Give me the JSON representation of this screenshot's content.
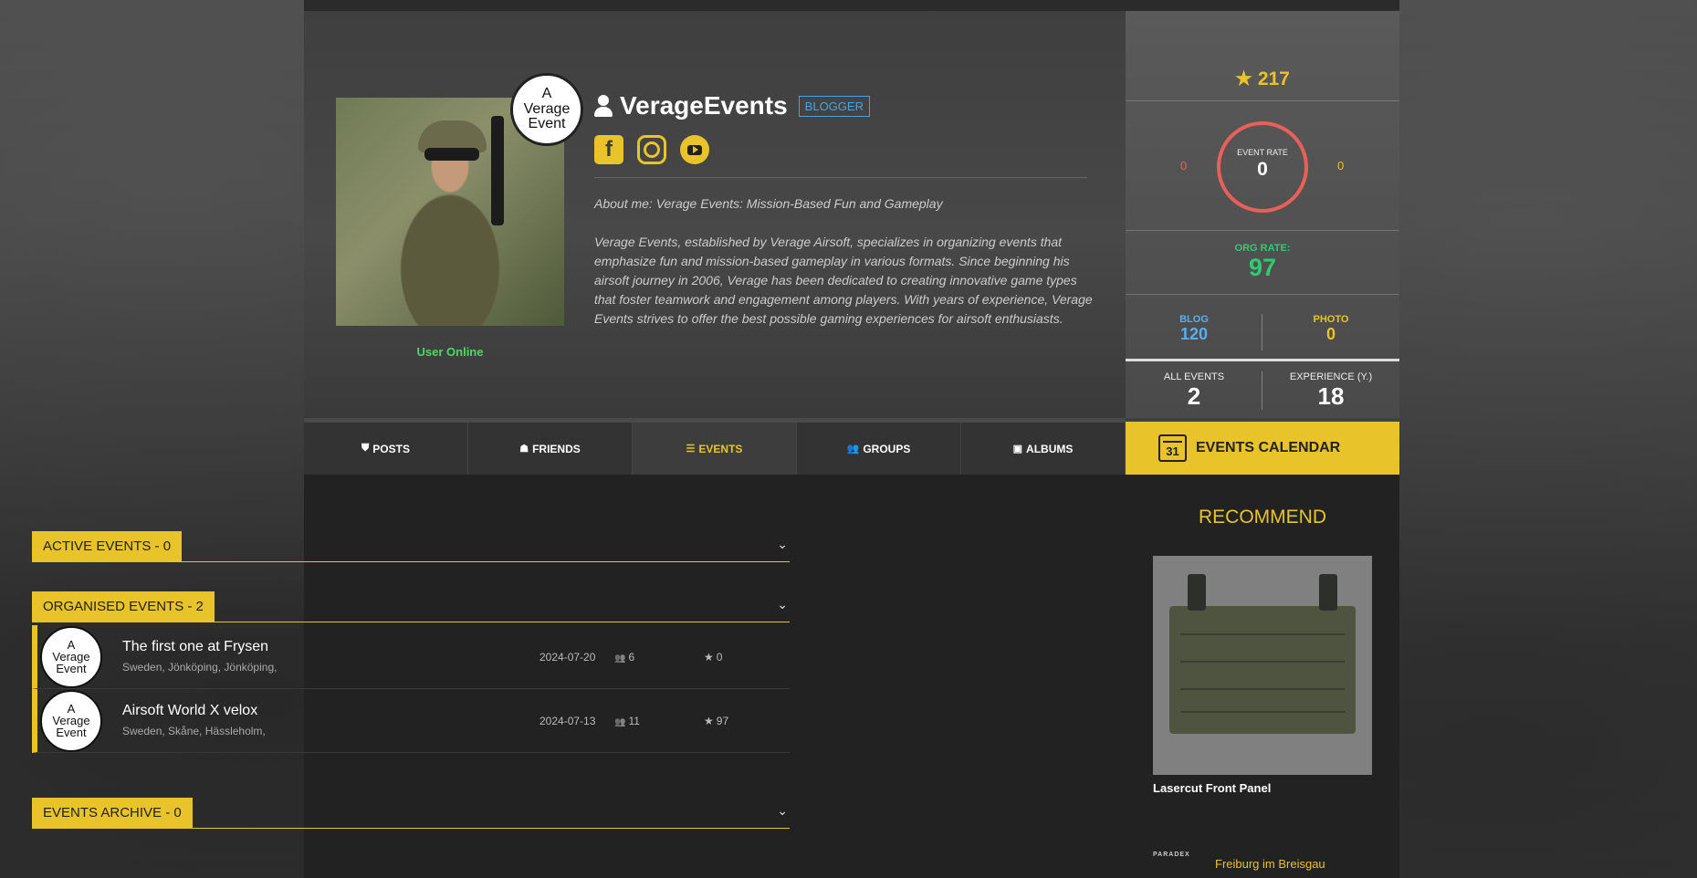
{
  "profile": {
    "username": "VerageEvents",
    "role_badge": "BLOGGER",
    "status": "User Online",
    "logo_lines": [
      "A",
      "Verage",
      "Event"
    ],
    "about_title": "About me: Verage Events: Mission-Based Fun and Gameplay",
    "about_text": "Verage Events, established by Verage Airsoft, specializes in organizing events that emphasize fun and mission-based gameplay in various formats. Since beginning his airsoft journey in 2006, Verage has been dedicated to creating innovative game types that foster teamwork and engagement among players. With years of experience, Verage Events strives to offer the best possible gaming experiences for airsoft enthusiasts.",
    "socials": [
      "facebook-icon",
      "instagram-icon",
      "youtube-icon"
    ]
  },
  "stats": {
    "rating": "217",
    "event_rate_label": "EVENT RATE",
    "event_rate_value": "0",
    "event_rate_left": "0",
    "event_rate_right": "0",
    "org_rate_label": "ORG RATE:",
    "org_rate_value": "97",
    "blog_label": "BLOG",
    "blog_value": "120",
    "photo_label": "PHOTO",
    "photo_value": "0",
    "all_events_label": "ALL EVENTS",
    "all_events_value": "2",
    "experience_label": "EXPERIENCE (Y.)",
    "experience_value": "18"
  },
  "tabs": [
    {
      "label": "POSTS",
      "icon": "shield-icon"
    },
    {
      "label": "FRIENDS",
      "icon": "person-icon"
    },
    {
      "label": "EVENTS",
      "icon": "list-icon",
      "active": true
    },
    {
      "label": "GROUPS",
      "icon": "users-icon"
    },
    {
      "label": "ALBUMS",
      "icon": "image-icon"
    }
  ],
  "calendar": {
    "label": "EVENTS CALENDAR",
    "icon_number": "31"
  },
  "sections": {
    "active": "ACTIVE EVENTS - 0",
    "organised": "ORGANISED EVENTS - 2",
    "archive": "EVENTS ARCHIVE - 0"
  },
  "events": [
    {
      "name": "The first one at Frysen",
      "location": "Sweden, Jönköping, Jönköping,",
      "date": "2024-07-20",
      "participants": "6",
      "rating": "0"
    },
    {
      "name": "Airsoft World X velox",
      "location": "Sweden, Skåne, Hässleholm,",
      "date": "2024-07-13",
      "participants": "11",
      "rating": "97"
    }
  ],
  "recommend": {
    "title": "RECOMMEND",
    "product_name": "Lasercut Front Panel",
    "brand": "PARADEX",
    "location": "Freiburg im Breisgau"
  },
  "colors": {
    "accent": "#e8c32a",
    "online": "#4cd964",
    "blog": "#5aaef0",
    "rate_ring": "#e8605a"
  }
}
